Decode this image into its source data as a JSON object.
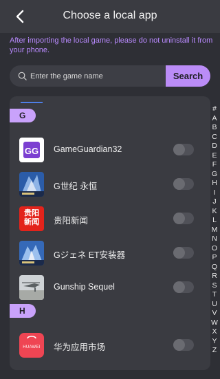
{
  "header": {
    "title": "Choose a local app"
  },
  "notice": "After importing the local game, please do not uninstall it from your phone.",
  "search": {
    "placeholder": "Enter the game name",
    "button_label": "Search"
  },
  "sections": [
    {
      "letter": "G",
      "apps": [
        {
          "name": "GameGuardian32",
          "icon": "gameguardian-icon",
          "enabled": false
        },
        {
          "name": "G世纪 永恒",
          "icon": "g-century-eternal-icon",
          "enabled": false
        },
        {
          "name": "贵阳新闻",
          "icon": "guiyang-news-icon",
          "enabled": false,
          "icon_text": [
            "贵阳",
            "新闻"
          ]
        },
        {
          "name": "Gジェネ ET安装器",
          "icon": "g-gene-et-installer-icon",
          "enabled": false
        },
        {
          "name": "Gunship Sequel",
          "icon": "gunship-sequel-icon",
          "enabled": false
        }
      ]
    },
    {
      "letter": "H",
      "apps": [
        {
          "name": "华为应用市场",
          "icon": "huawei-appgallery-icon",
          "enabled": false,
          "icon_text": "HUAWEI"
        }
      ]
    }
  ],
  "index_letters": [
    "#",
    "A",
    "B",
    "C",
    "D",
    "E",
    "F",
    "G",
    "H",
    "I",
    "J",
    "K",
    "L",
    "M",
    "N",
    "O",
    "P",
    "Q",
    "R",
    "S",
    "T",
    "U",
    "V",
    "W",
    "X",
    "Y",
    "Z"
  ],
  "colors": {
    "accent": "#bb8cf7",
    "notice": "#b98aff",
    "background": "#2e2f35",
    "panel": "#3a3b41"
  }
}
